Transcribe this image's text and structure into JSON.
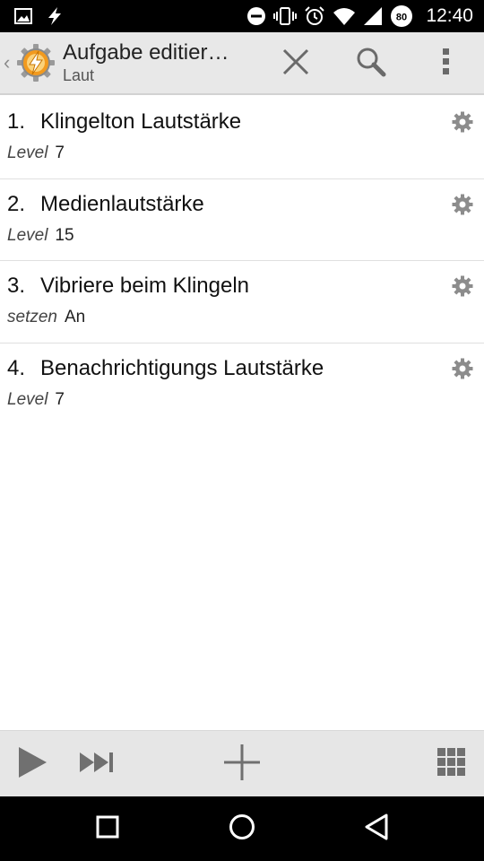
{
  "status_bar": {
    "time": "12:40",
    "battery": "80",
    "icons": [
      "image-icon",
      "flash-icon",
      "do-not-disturb-icon",
      "vibrate-icon",
      "alarm-icon",
      "wifi-icon",
      "signal-icon",
      "battery-icon"
    ]
  },
  "action_bar": {
    "title": "Aufgabe editier…",
    "subtitle": "Laut",
    "icons": [
      "up-caret-icon",
      "tasker-logo",
      "close-icon",
      "search-icon",
      "overflow-menu-icon"
    ]
  },
  "actions": [
    {
      "number": "1.",
      "name": "Klingelton Lautstärke",
      "param_label": "Level",
      "param_value": "7"
    },
    {
      "number": "2.",
      "name": "Medienlautstärke",
      "param_label": "Level",
      "param_value": "15"
    },
    {
      "number": "3.",
      "name": "Vibriere beim Klingeln",
      "param_label": "setzen",
      "param_value": "An"
    },
    {
      "number": "4.",
      "name": "Benachrichtigungs Lautstärke",
      "param_label": "Level",
      "param_value": "7"
    }
  ],
  "toolbar": {
    "icons": [
      "play-icon",
      "skip-forward-icon",
      "add-icon",
      "grid-icon"
    ]
  },
  "nav_bar": {
    "icons": [
      "recents-icon",
      "home-icon",
      "back-icon"
    ]
  },
  "colors": {
    "action_bar_bg": "#e8e8e8",
    "toolbar_bg": "#e6e6e6",
    "status_bar_bg": "#000000",
    "gear": "#8c8c8c",
    "logo_orange": "#f29a1e"
  }
}
